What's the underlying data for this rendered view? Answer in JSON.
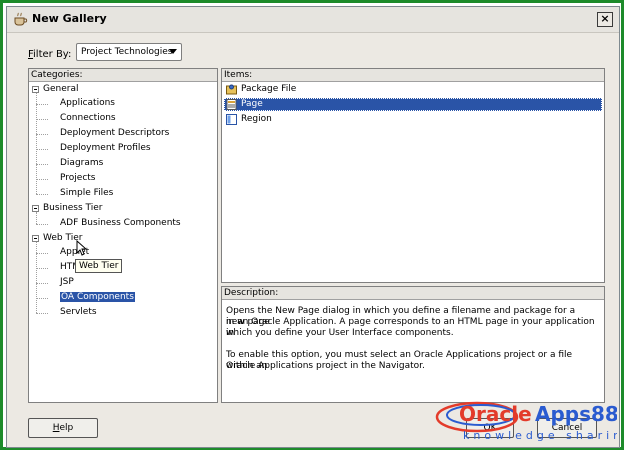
{
  "window": {
    "title": "New Gallery",
    "close_symbol": "×"
  },
  "filter": {
    "label_prefix": "F",
    "label_rest": "ilter By:",
    "value": "Project Technologies"
  },
  "categories": {
    "header": "Categories:",
    "tree": [
      {
        "label": "General",
        "level": 0,
        "expanded": true
      },
      {
        "label": "Applications",
        "level": 1
      },
      {
        "label": "Connections",
        "level": 1
      },
      {
        "label": "Deployment Descriptors",
        "level": 1
      },
      {
        "label": "Deployment Profiles",
        "level": 1
      },
      {
        "label": "Diagrams",
        "level": 1
      },
      {
        "label": "Projects",
        "level": 1
      },
      {
        "label": "Simple Files",
        "level": 1
      },
      {
        "label": "Business Tier",
        "level": 0,
        "expanded": true
      },
      {
        "label": "ADF Business Components",
        "level": 1
      },
      {
        "label": "Web Tier",
        "level": 0,
        "expanded": true
      },
      {
        "label": "Applet",
        "level": 1
      },
      {
        "label": "HTML",
        "level": 1
      },
      {
        "label": "JSP",
        "level": 1
      },
      {
        "label": "OA Components",
        "level": 1,
        "selected": true
      },
      {
        "label": "Servlets",
        "level": 1
      }
    ]
  },
  "tooltip": "Web Tier",
  "items": {
    "header": "Items:",
    "list": [
      {
        "label": "Package File",
        "icon": "package-file-icon"
      },
      {
        "label": "Page",
        "icon": "page-icon",
        "selected": true
      },
      {
        "label": "Region",
        "icon": "region-icon"
      }
    ]
  },
  "description": {
    "header": "Description:",
    "paragraph1": [
      "Opens the New Page dialog in which you define a filename and package for a new page",
      "in an Oracle Application. A page corresponds to an HTML page in your application in",
      "which you define your User Interface components."
    ],
    "paragraph2": [
      "To enable this option, you must select an Oracle Applications project or a file within an",
      "Oracle Applications project in the Navigator."
    ]
  },
  "buttons": {
    "help": "Help",
    "help_mnemonic": "H",
    "help_rest": "elp",
    "ok": "OK",
    "cancel": "Cancel"
  },
  "watermark": {
    "brand1": "Oracle",
    "brand2": "Apps88",
    "tagline": "knowledge sharing"
  },
  "colors": {
    "selection": "#2a54a7",
    "frame": "#1d8b2a",
    "dialog": "#ece9e3"
  }
}
